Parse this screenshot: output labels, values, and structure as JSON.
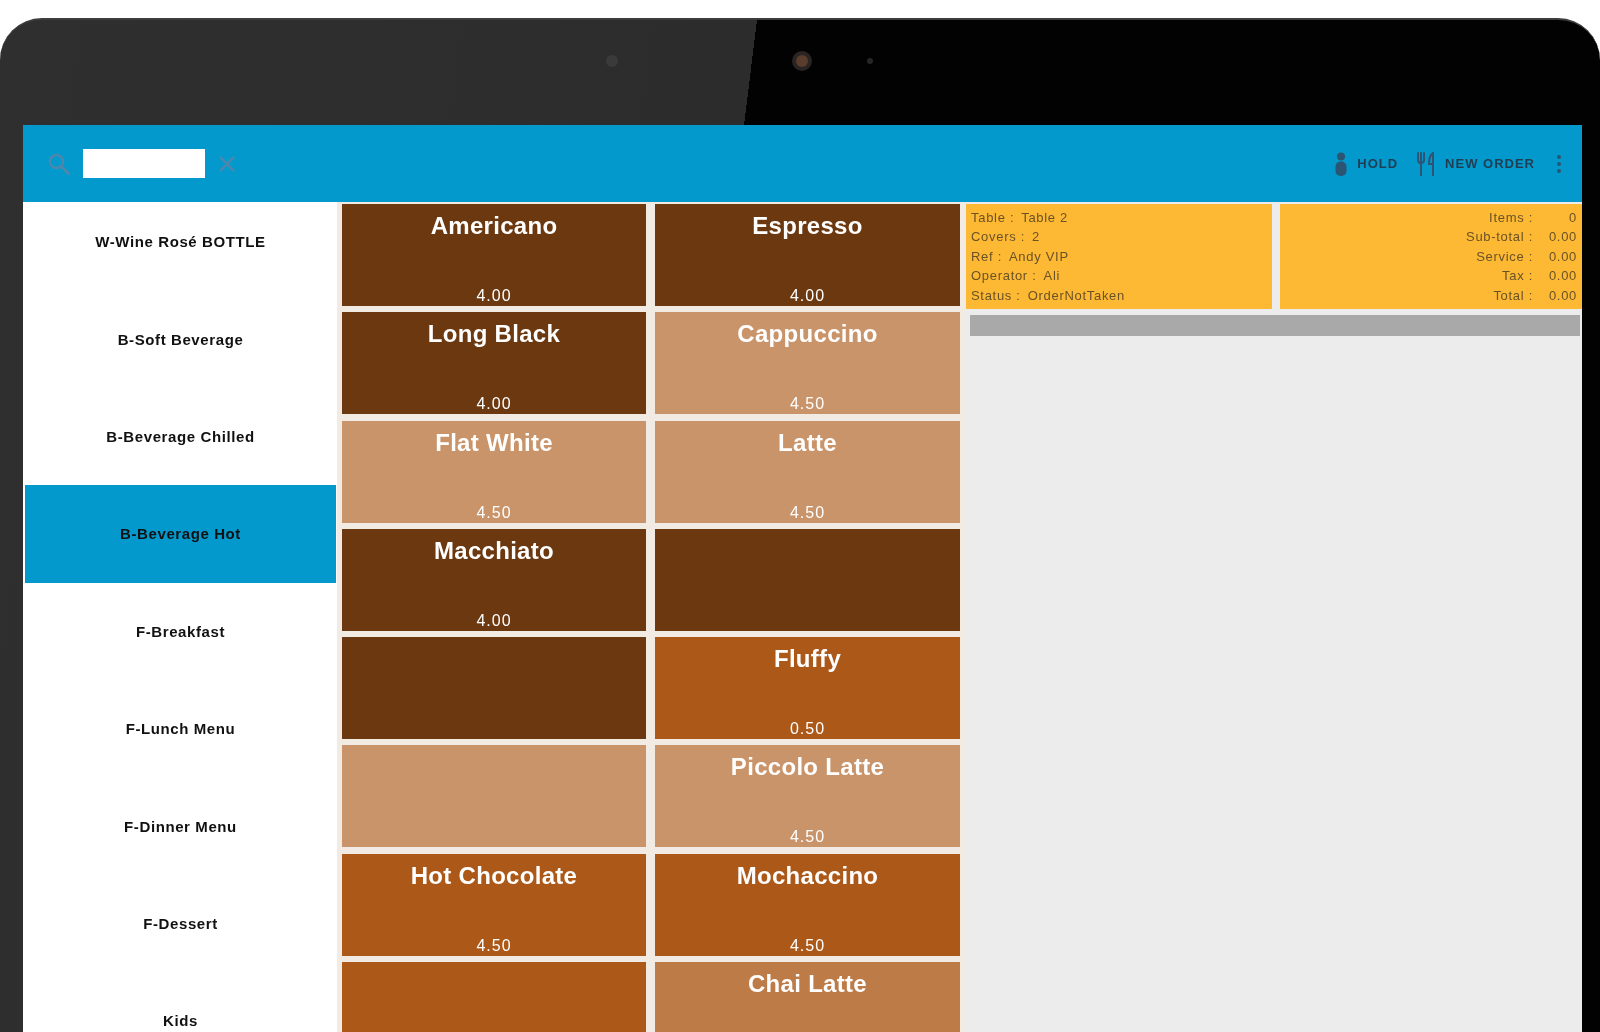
{
  "header": {
    "actions": [
      {
        "label": "HOLD"
      },
      {
        "label": "NEW ORDER"
      }
    ]
  },
  "categories": [
    {
      "label": "W-Wine Rosé BOTTLE",
      "selected": false
    },
    {
      "label": "B-Soft Beverage",
      "selected": false
    },
    {
      "label": "B-Beverage Chilled",
      "selected": false
    },
    {
      "label": "B-Beverage Hot",
      "selected": true
    },
    {
      "label": "F-Breakfast",
      "selected": false
    },
    {
      "label": "F-Lunch Menu",
      "selected": false
    },
    {
      "label": "F-Dinner Menu",
      "selected": false
    },
    {
      "label": "F-Dessert",
      "selected": false
    },
    {
      "label": "Kids",
      "selected": false
    }
  ],
  "products": [
    {
      "name": "Americano",
      "price": "4.00",
      "color": "#6b3810"
    },
    {
      "name": "Espresso",
      "price": "4.00",
      "color": "#6b3810"
    },
    {
      "name": "Long Black",
      "price": "4.00",
      "color": "#6b3810"
    },
    {
      "name": "Cappuccino",
      "price": "4.50",
      "color": "#c9946a"
    },
    {
      "name": "Flat White",
      "price": "4.50",
      "color": "#c9946a"
    },
    {
      "name": "Latte",
      "price": "4.50",
      "color": "#c9946a"
    },
    {
      "name": "Macchiato",
      "price": "4.00",
      "color": "#6b3810"
    },
    {
      "color": "#6b3810"
    },
    {
      "color": "#6b3810"
    },
    {
      "name": "Fluffy",
      "price": "0.50",
      "color": "#ac5818"
    },
    {
      "color": "#c9946a"
    },
    {
      "name": "Piccolo Latte",
      "price": "4.50",
      "color": "#c9946a"
    },
    {
      "name": "Hot Chocolate",
      "price": "4.50",
      "color": "#ac5818"
    },
    {
      "name": "Mochaccino",
      "price": "4.50",
      "color": "#ac5818"
    },
    {
      "color": "#ac5818"
    },
    {
      "name": "Chai Latte",
      "color": "#bd7b47"
    }
  ],
  "order": {
    "details": [
      {
        "label": "Table :",
        "value": "Table 2"
      },
      {
        "label": "Covers :",
        "value": "2"
      },
      {
        "label": "Ref :",
        "value": "Andy VIP"
      },
      {
        "label": "Operator :",
        "value": "Ali"
      },
      {
        "label": "Status :",
        "value": "OrderNotTaken"
      }
    ],
    "totals": [
      {
        "label": "Items :",
        "value": "0"
      },
      {
        "label": "Sub-total :",
        "value": "0.00"
      },
      {
        "label": "Service :",
        "value": "0.00"
      },
      {
        "label": "Tax :",
        "value": "0.00"
      },
      {
        "label": "Total :",
        "value": "0.00"
      }
    ]
  }
}
